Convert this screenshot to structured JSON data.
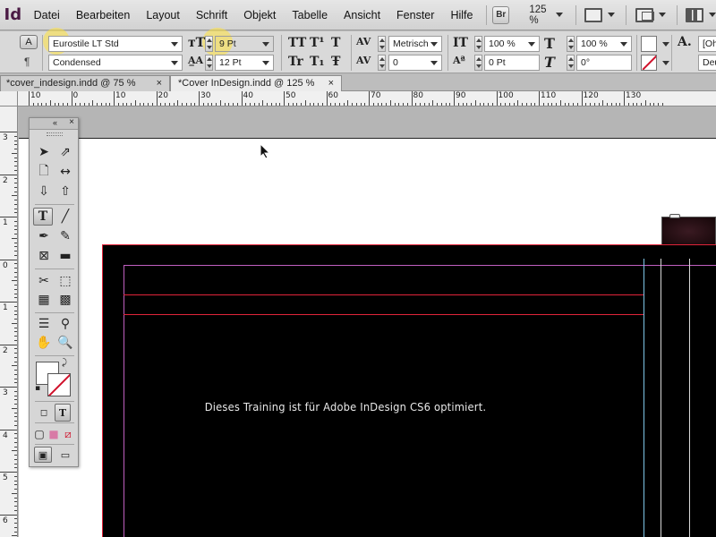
{
  "app": {
    "logo": "Id"
  },
  "menu": {
    "items": [
      "Datei",
      "Bearbeiten",
      "Layout",
      "Schrift",
      "Objekt",
      "Tabelle",
      "Ansicht",
      "Fenster",
      "Hilfe"
    ],
    "bridge_label": "Br",
    "zoom": "125 %"
  },
  "control": {
    "font_family": "Eurostile LT Std",
    "font_style": "Condensed",
    "font_size": "9 Pt",
    "leading": "12 Pt",
    "kerning": "Metrisch",
    "tracking": "0",
    "vertical_scale": "100 %",
    "baseline_shift": "0 Pt",
    "horizontal_scale": "100 %",
    "skew": "0°",
    "truncated_right_top": "[Oh",
    "truncated_right_bottom": "Deu",
    "char_button": "A",
    "para_button": "¶"
  },
  "tabs": [
    {
      "label": "*cover_indesign.indd @ 75 %",
      "active": false
    },
    {
      "label": "*Cover InDesign.indd @ 125 %",
      "active": true
    }
  ],
  "rulers": {
    "horizontal": [
      "10",
      "0",
      "10",
      "20",
      "30",
      "40",
      "50",
      "60",
      "70",
      "80",
      "90",
      "100",
      "110",
      "120",
      "130"
    ],
    "vertical": [
      "3",
      "2",
      "1",
      "0",
      "1",
      "2",
      "3",
      "4",
      "5",
      "6"
    ]
  },
  "document": {
    "headline": "Dieses Training ist für Adobe InDesign CS6 optimiert."
  },
  "colors": {
    "highlight": "#ffe13c",
    "bleed_guide": "#e0243a",
    "margin_guide": "#c060c0",
    "column_guide": "#7fc7e8"
  }
}
